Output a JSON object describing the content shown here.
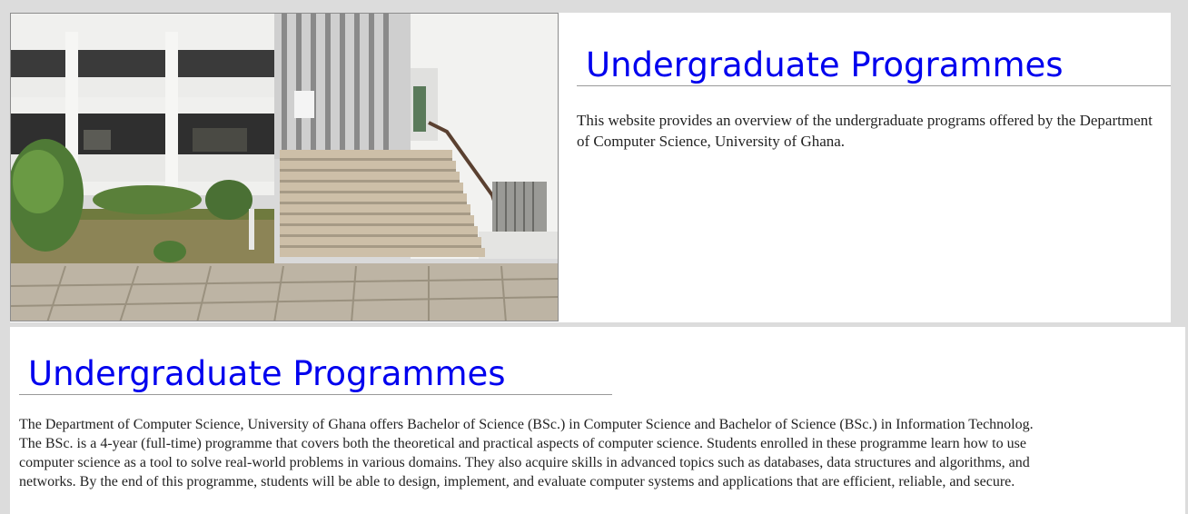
{
  "hero": {
    "image_alt": "Department of Computer Science building with stairs",
    "title": "Undergraduate Programmes",
    "description": "This website provides an overview of the undergraduate programs offered by the Department of Computer Science, University of Ghana."
  },
  "detail": {
    "title": "Undergraduate Programmes",
    "line1": "The Department of Computer Science, University of Ghana offers Bachelor of Science (BSc.) in Computer Science and Bachelor of Science (BSc.) in Information Technolog.",
    "line2": "The BSc. is a 4-year (full-time) programme that covers both the theoretical and practical aspects of computer science. Students enrolled in these programme learn how to use",
    "line3": "computer science as a tool to solve real-world problems in various domains. They also acquire skills in advanced topics such as databases, data structures and algorithms, and",
    "line4": "networks. By the end of this programme, students will be able to design, implement, and evaluate computer systems and applications that are efficient, reliable, and secure."
  }
}
